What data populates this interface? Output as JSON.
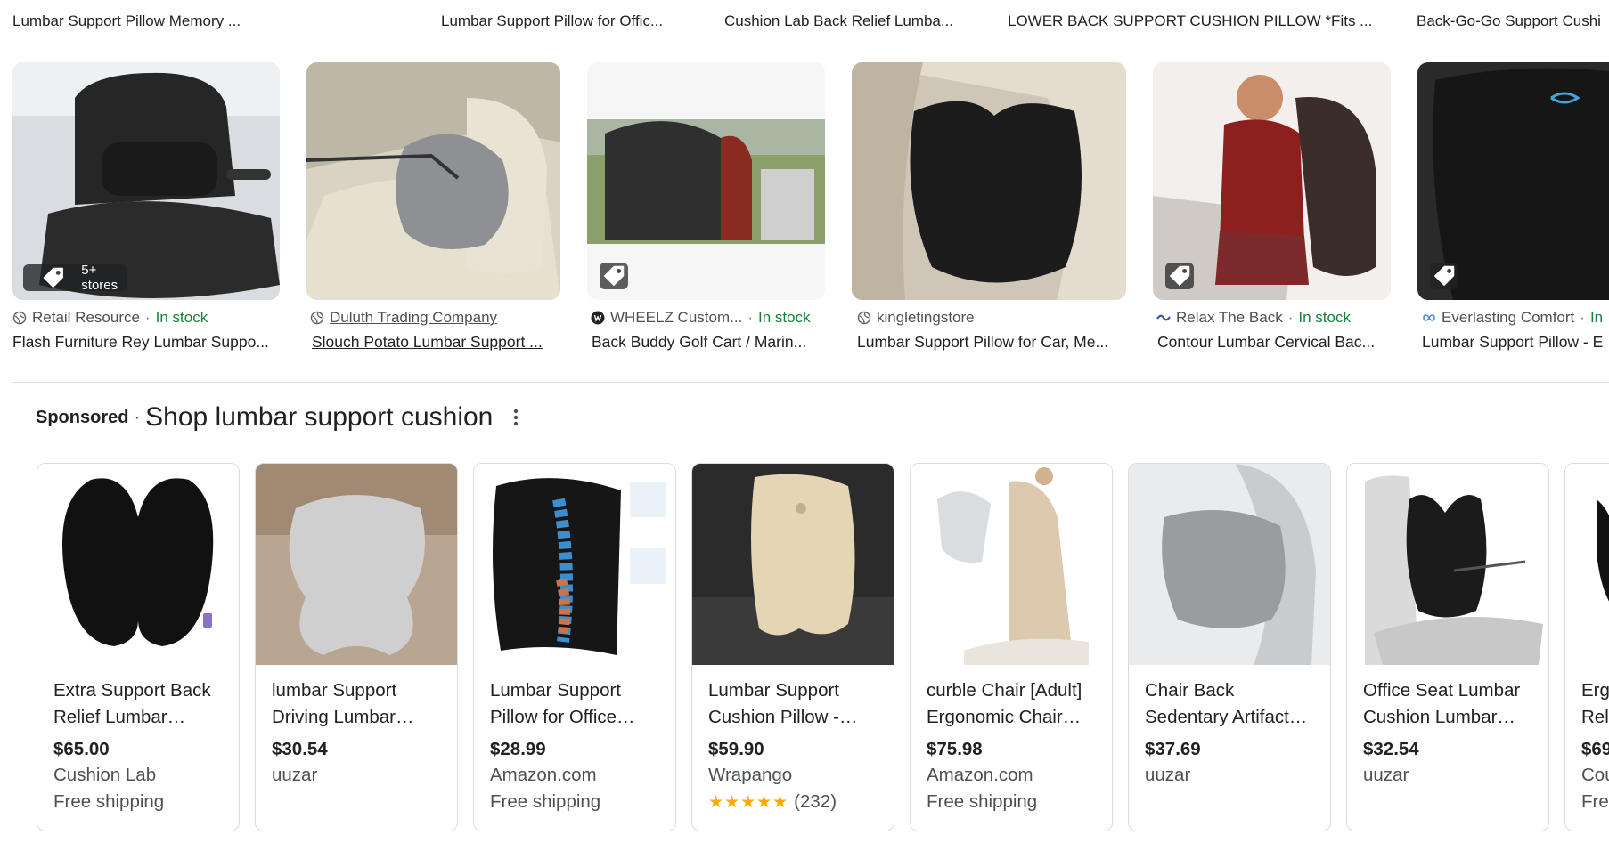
{
  "image_results": [
    {
      "title": "Lumbar Support Pillow Memory ...",
      "badge": "5+ stores",
      "source": "Retail Resource",
      "stock": "In stock",
      "name": "Flash Furniture Rey Lumbar Suppo...",
      "source_icon": "globe-icon"
    },
    {
      "title": "Lumbar Support Pillow for Offic...",
      "source": "Duluth Trading Company",
      "name": "Slouch Potato Lumbar Support ...",
      "source_icon": "globe-icon"
    },
    {
      "title": "Cushion Lab Back Relief Lumba...",
      "source": "WHEELZ Custom...",
      "stock": "In stock",
      "name": "Back Buddy Golf Cart / Marin...",
      "source_icon": "store-logo-icon"
    },
    {
      "title": "LOWER BACK SUPPORT CUSHION PILLOW *Fits ...",
      "source": "kingletingstore",
      "name": "Lumbar Support Pillow for Car, Me...",
      "source_icon": "globe-icon"
    },
    {
      "title": "Back-Go-Go Support Cushi",
      "source": "Relax The Back",
      "stock": "In stock",
      "name": "Contour Lumbar Cervical Bac...",
      "source_icon": "store-logo-icon"
    },
    {
      "source": "Everlasting Comfort",
      "stock": "In",
      "name": "Lumbar Support Pillow - E",
      "source_icon": "infinity-icon"
    }
  ],
  "sponsored": {
    "label": "Sponsored",
    "separator": "·",
    "title": "Shop lumbar support cushion",
    "cards": [
      {
        "title": "Extra Support Back Relief Lumbar…",
        "price": "$65.00",
        "seller": "Cushion Lab",
        "shipping": "Free shipping"
      },
      {
        "title": "lumbar Support Driving Lumbar…",
        "price": "$30.54",
        "seller": "uuzar"
      },
      {
        "title": "Lumbar Support Pillow for Office…",
        "price": "$28.99",
        "seller": "Amazon.com",
        "shipping": "Free shipping"
      },
      {
        "title": "Lumbar Support Cushion Pillow -…",
        "price": "$59.90",
        "seller": "Wrapango",
        "stars": "★★★★★",
        "rating": 4.5,
        "reviews": "(232)"
      },
      {
        "title": "curble Chair [Adult] Ergonomic Chair…",
        "price": "$75.98",
        "seller": "Amazon.com",
        "shipping": "Free shipping"
      },
      {
        "title": "Chair Back Sedentary Artifact…",
        "price": "$37.69",
        "seller": "uuzar"
      },
      {
        "title": "Office Seat Lumbar Cushion Lumbar…",
        "price": "$32.54",
        "seller": "uuzar"
      },
      {
        "title": "Erg Rel",
        "price": "$69",
        "seller": "Cou",
        "shipping": "Fre"
      }
    ]
  },
  "colors": {
    "in_stock": "#188038",
    "text": "#202124",
    "secondary": "#4d5156",
    "star": "#f9ab00",
    "divider": "#dadce0"
  }
}
